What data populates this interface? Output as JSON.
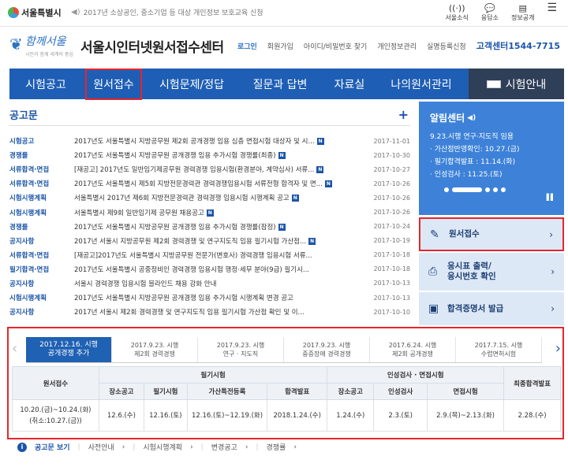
{
  "topbar": {
    "seoul_brand": "서울특별시",
    "ticker": "2017년 소상공인, 중소기업 등 대상 개인정보 보호교육 신청",
    "util_links": [
      {
        "label": "서울소식",
        "icon": "wifi-icon"
      },
      {
        "label": "응답소",
        "icon": "chat-icon"
      },
      {
        "label": "정보공개",
        "icon": "document-icon"
      },
      {
        "label": "",
        "icon": "menu-icon"
      }
    ]
  },
  "header": {
    "logo_script": "함께서울",
    "logo_tagline": "시민과 함께 세계의 중심",
    "title": "서울시인터넷원서접수센터",
    "member_links": [
      "로그인",
      "회원가입",
      "아이디/비밀번호 찾기",
      "개인정보관리",
      "실명등록신청"
    ],
    "callcenter": "고객센터1544-7715"
  },
  "gnb": {
    "items": [
      "시험공고",
      "원서접수",
      "시험문제/정답",
      "질문과 답변",
      "자료실",
      "나의원서관리"
    ],
    "exam_info": "시험안내"
  },
  "notice": {
    "title": "공고문",
    "rows": [
      {
        "cat": "시험공고",
        "title": "2017년도 서울특별시 지방공무원 제2회 공개경쟁 임용 심층 면접시험 대상자 및 시...",
        "new": true,
        "date": "2017-11-01"
      },
      {
        "cat": "경쟁률",
        "title": "2017년도 서울특별시 지방공무원 공개경쟁 임용 추가시험 경쟁률(최종)",
        "new": true,
        "date": "2017-10-30"
      },
      {
        "cat": "서류합격·면접",
        "title": "[재공고] 2017년도 일반임기제공무원 경력경쟁 임용시험(환경분야, 계약심사) 서류...",
        "new": true,
        "date": "2017-10-27"
      },
      {
        "cat": "서류합격·면접",
        "title": "2017년도 서울특별시 제5회 지방전문경력관 경력경쟁임용시험 서류전형 합격자 및 면...",
        "new": true,
        "date": "2017-10-26"
      },
      {
        "cat": "시험시행계획",
        "title": "서울특별시 2017년 제6회 지방전문경력관 경력경쟁 임용시험 시행계획 공고",
        "new": true,
        "date": "2017-10-26"
      },
      {
        "cat": "시험시행계획",
        "title": "서울특별시 제9회 일반임기제 공무원 채용공고",
        "new": true,
        "date": "2017-10-26"
      },
      {
        "cat": "경쟁률",
        "title": "2017년도 서울특별시 지방공무원 공개경쟁 임용 추가시험 경쟁률(잠정)",
        "new": true,
        "date": "2017-10-24"
      },
      {
        "cat": "공지사항",
        "title": "2017년 서울시 지방공무원 제2회 경력경쟁 및 연구지도직 임용 필기시험 가산점...",
        "new": true,
        "date": "2017-10-19"
      },
      {
        "cat": "서류합격·면접",
        "title": "[재공고]2017년도 서울특별시 지방공무원 전문가(변호사) 경력경쟁 임용시험 서류...",
        "new": false,
        "date": "2017-10-18"
      },
      {
        "cat": "필기합격·면접",
        "title": "2017년도 서울특별시 공중정비인 경력경쟁 임용시험 행정·세무 분야(9급) 필기시...",
        "new": false,
        "date": "2017-10-18"
      },
      {
        "cat": "공지사항",
        "title": "서울시 경력경쟁 임용시험 블라인드 채용 강화 안내",
        "new": false,
        "date": "2017-10-13"
      },
      {
        "cat": "시험시행계획",
        "title": "2017년도 서울특별시 지방공무원 공개경쟁 임용 추가시험 시행계획 변경 공고",
        "new": false,
        "date": "2017-10-13"
      },
      {
        "cat": "공지사항",
        "title": "2017년 서울시 제2회 경력경쟁 및 연구지도직 임용 필기시험 가산점 확인 및 이...",
        "new": false,
        "date": "2017-10-10"
      }
    ],
    "new_badge": "N"
  },
  "alert_center": {
    "title": "알림센터",
    "lines": [
      "9.23.시행 연구·지도직 임용",
      "· 가산점반영확인: 10.27.(금)",
      "· 필기합격발표 : 11.14.(화)",
      "· 인성검사 : 11.25.(토)"
    ]
  },
  "quick": [
    {
      "label": "원서접수",
      "icon": "pencil-icon"
    },
    {
      "label": "응시표 출력/\n응시번호 확인",
      "icon": "printer-icon"
    },
    {
      "label": "합격증명서 발급",
      "icon": "certificate-icon"
    }
  ],
  "schedule": {
    "tabs": [
      {
        "line1": "2017.12.16. 시행",
        "line2": "공개경쟁 추가"
      },
      {
        "line1": "2017.9.23. 시행",
        "line2": "제2회 경력경쟁"
      },
      {
        "line1": "2017.9.23. 시행",
        "line2": "연구 · 지도직"
      },
      {
        "line1": "2017.9.23. 시행",
        "line2": "중증장애 경력경쟁"
      },
      {
        "line1": "2017.6.24. 시행",
        "line2": "제2회 공개경쟁"
      },
      {
        "line1": "2017.7.15. 시행",
        "line2": "수렵면허시험"
      }
    ],
    "group_headers": {
      "apply": "원서접수",
      "written": "필기시험",
      "interview": "인성검사 · 면접시험",
      "final": "최종합격발표"
    },
    "sub_headers": [
      "장소공고",
      "필기시험",
      "가산특전등록",
      "합격발표",
      "장소공고",
      "인성검사",
      "면접시험"
    ],
    "row": {
      "apply": "10.20.(금)~10.24.(화)",
      "apply_note": "(취소:10.27.(금))",
      "cells": [
        "12.6.(수)",
        "12.16.(토)",
        "12.16.(토)~12.19.(화)",
        "2018.1.24.(수)",
        "1.24.(수)",
        "2.3.(토)",
        "2.9.(목)~2.13.(화)"
      ],
      "final": "2.28.(수)"
    }
  },
  "bottom_links": {
    "lead": "공고문 보기",
    "items": [
      "사전안내",
      "시험시행계획",
      "변경공고",
      "경쟁률"
    ]
  }
}
